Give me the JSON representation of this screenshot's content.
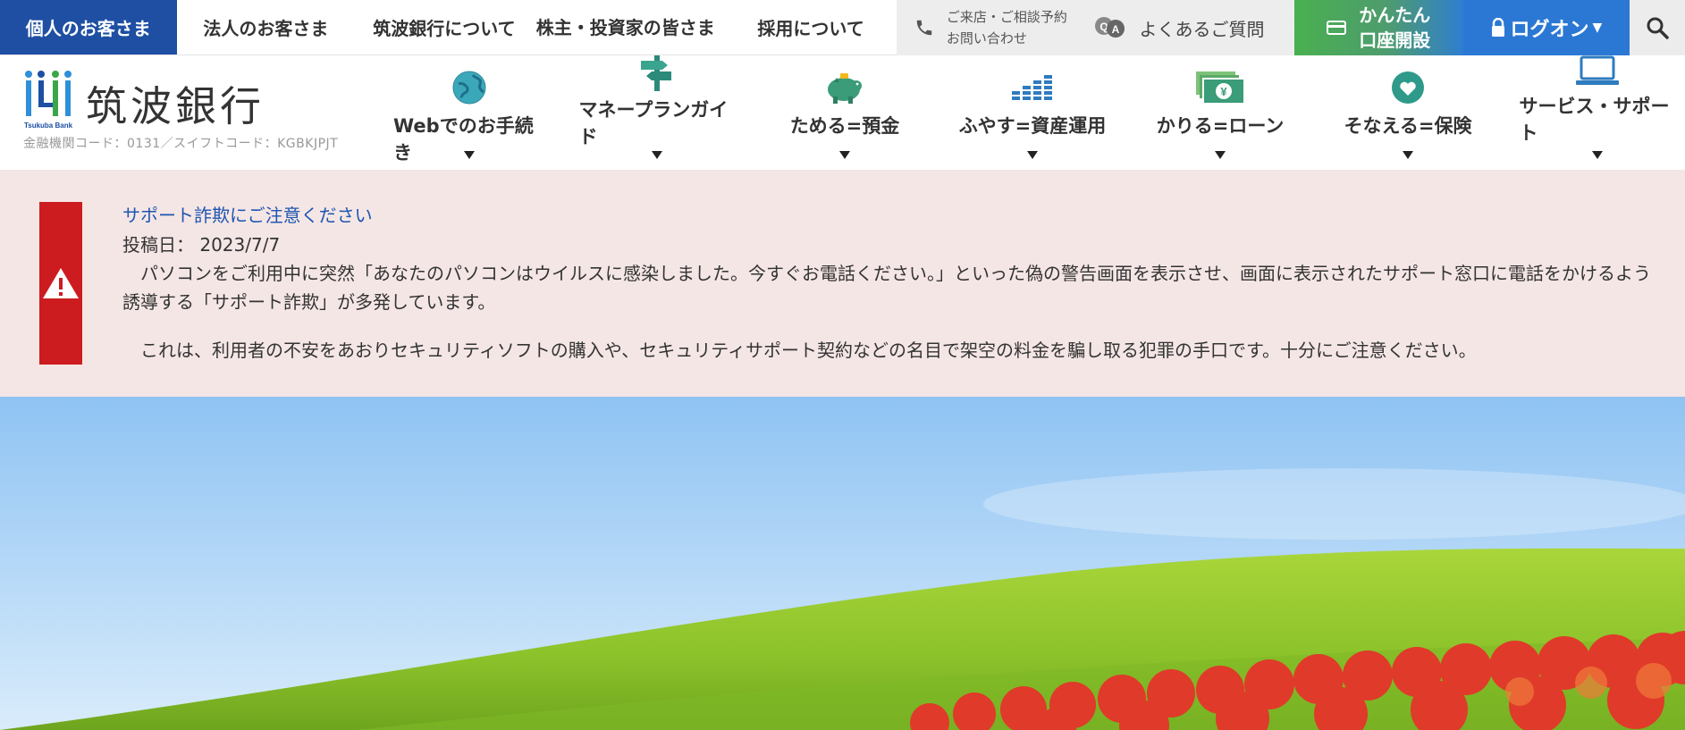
{
  "topbar": {
    "tabs": [
      {
        "label": "個人のお客さま",
        "active": true
      },
      {
        "label": "法人のお客さま",
        "active": false
      },
      {
        "label": "筑波銀行について",
        "active": false
      },
      {
        "label": "株主・投資家の皆さま",
        "active": false
      },
      {
        "label": "採用について",
        "active": false
      }
    ],
    "contact": {
      "line1": "ご来店・ご相談予約",
      "line2": "お問い合わせ",
      "icon": "phone-icon"
    },
    "faq": {
      "label": "よくあるご質問",
      "icon": "faq-chat-icon"
    },
    "open_account": {
      "line1": "かんたん",
      "line2": "口座開設",
      "icon": "card-icon"
    },
    "logon": {
      "label": "ログオン",
      "icon": "lock-icon"
    },
    "search": {
      "icon": "search-icon"
    }
  },
  "brand": {
    "name": "筑波銀行",
    "logo_text": "Tsukuba Bank",
    "code_line": "金融機関コード：0131／スイフトコード：KGBKJPJT"
  },
  "mainnav": {
    "items": [
      {
        "label": "Webでのお手続き",
        "icon": "globe-icon"
      },
      {
        "label": "マネープランガイド",
        "icon": "signpost-icon"
      },
      {
        "label": "ためる=預金",
        "icon": "piggy-bank-icon"
      },
      {
        "label": "ふやす=資産運用",
        "icon": "bar-growth-icon"
      },
      {
        "label": "かりる=ローン",
        "icon": "banknote-icon"
      },
      {
        "label": "そなえる=保険",
        "icon": "heart-icon"
      },
      {
        "label": "サービス・サポート",
        "icon": "laptop-icon"
      }
    ]
  },
  "alert": {
    "title": "サポート詐欺にご注意ください",
    "date": "投稿日： 2023/7/7",
    "body1": "パソコンをご利用中に突然「あなたのパソコンはウイルスに感染しました。今すぐお電話ください。」といった偽の警告画面を表示させ、画面に表示されたサポート窓口に電話をかけるよう誘導する「サポート詐欺」が多発しています。",
    "body2": "これは、利用者の不安をあおりセキュリティソフトの購入や、セキュリティサポート契約などの名目で架空の料金を騙し取る犯罪の手口です。十分にご注意ください。",
    "icon": "warning-icon"
  },
  "colors": {
    "brand_blue": "#1e4fa3",
    "alert_red": "#cc1c1f",
    "alert_bg": "#f5e6e6",
    "link_blue": "#1e56b0"
  }
}
